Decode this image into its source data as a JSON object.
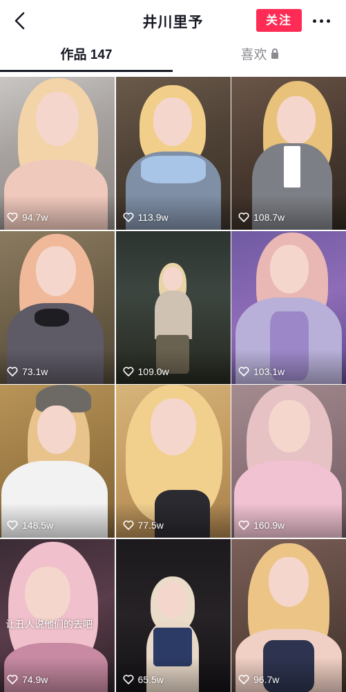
{
  "header": {
    "title": "井川里予",
    "follow_label": "关注"
  },
  "tabs": {
    "works_label": "作品 147",
    "likes_label": "喜欢"
  },
  "videos": [
    {
      "likes": "94.7w",
      "caption": ""
    },
    {
      "likes": "113.9w",
      "caption": ""
    },
    {
      "likes": "108.7w",
      "caption": ""
    },
    {
      "likes": "73.1w",
      "caption": ""
    },
    {
      "likes": "109.0w",
      "caption": ""
    },
    {
      "likes": "103.1w",
      "caption": ""
    },
    {
      "likes": "148.5w",
      "caption": ""
    },
    {
      "likes": "77.5w",
      "caption": ""
    },
    {
      "likes": "160.9w",
      "caption": ""
    },
    {
      "likes": "74.9w",
      "caption": "让丑人说他们的去吧"
    },
    {
      "likes": "65.5w",
      "caption": ""
    },
    {
      "likes": "96.7w",
      "caption": ""
    }
  ],
  "colors": {
    "accent": "#fe2c55",
    "text_primary": "#161823",
    "text_secondary": "#8a8b91"
  }
}
